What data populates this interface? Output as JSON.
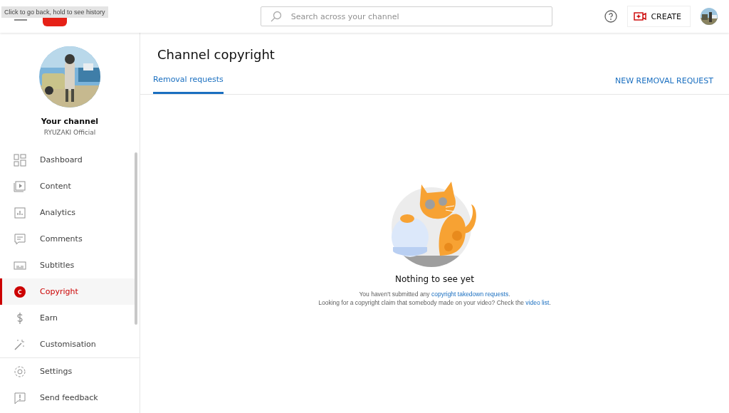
{
  "tooltip": "Click to go back, hold to see history",
  "search": {
    "placeholder": "Search across your channel"
  },
  "header": {
    "create_label": "CREATE"
  },
  "channel": {
    "title": "Your channel",
    "name": "RYUZAKI Official"
  },
  "sidebar": {
    "items": [
      {
        "label": "Dashboard",
        "selected": false
      },
      {
        "label": "Content",
        "selected": false
      },
      {
        "label": "Analytics",
        "selected": false
      },
      {
        "label": "Comments",
        "selected": false
      },
      {
        "label": "Subtitles",
        "selected": false
      },
      {
        "label": "Copyright",
        "selected": true
      },
      {
        "label": "Earn",
        "selected": false
      },
      {
        "label": "Customisation",
        "selected": false
      }
    ],
    "footer_items": [
      {
        "label": "Settings"
      },
      {
        "label": "Send feedback"
      }
    ]
  },
  "page": {
    "title": "Channel copyright",
    "tabs": [
      {
        "label": "Removal requests",
        "selected": true
      }
    ],
    "action": "NEW REMOVAL REQUEST"
  },
  "empty_state": {
    "title": "Nothing to see yet",
    "line_1": {
      "text": "You haven't submitted any ",
      "link": "copyright takedown requests",
      "end": "."
    },
    "line_2": {
      "text": "Looking for a copyright claim that somebody made on your video? Check the ",
      "link": "video list",
      "end": "."
    }
  }
}
